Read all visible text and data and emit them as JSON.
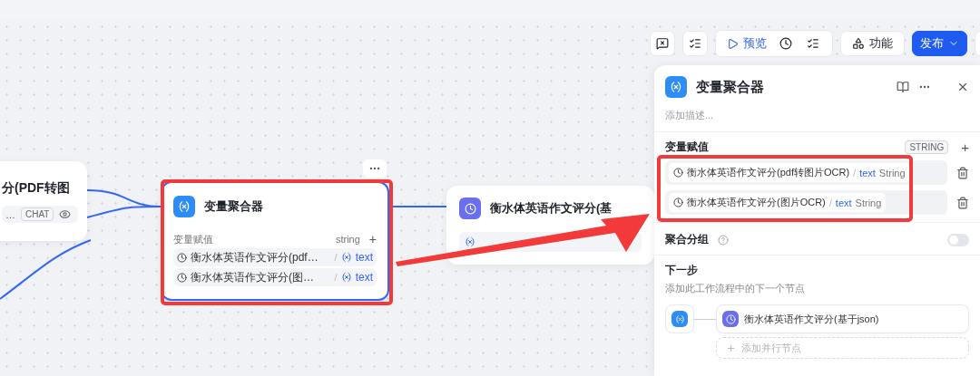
{
  "toolbar": {
    "preview": "预览",
    "features": "功能",
    "publish": "发布"
  },
  "canvas": {
    "nodes": [
      {
        "kind": "source",
        "selected": false,
        "title": "分(PDF转图",
        "rows": [
          {
            "text": "…",
            "badge": "CHAT"
          }
        ]
      },
      {
        "kind": "aggregator",
        "selected": true,
        "title": "变量聚合器",
        "section": "变量赋值",
        "type": "string",
        "add": "+",
        "rows": [
          {
            "name": "衡水体英语作文评分(pdf…",
            "sep": "/",
            "var": "text"
          },
          {
            "name": "衡水体英语作文评分(图…",
            "sep": "/",
            "var": "text"
          }
        ]
      },
      {
        "kind": "llm",
        "selected": false,
        "title": "衡水体英语作文评分(基"
      }
    ]
  },
  "panel": {
    "title": "变量聚合器",
    "description_placeholder": "添加描述...",
    "assign": {
      "label": "变量赋值",
      "type": "STRING",
      "add": "+",
      "rows": [
        {
          "name": "衡水体英语作文评分(pdf转图片OCR)",
          "sep": "/",
          "var": "text",
          "type": "String"
        },
        {
          "name": "衡水体英语作文评分(图片OCR)",
          "sep": "/",
          "var": "text",
          "type": "String"
        }
      ]
    },
    "aggregate_group": {
      "label": "聚合分组",
      "on": false
    },
    "next": {
      "title": "下一步",
      "hint": "添加此工作流程中的下一个节点",
      "node": "衡水体英语作文评分(基于json)",
      "add_parallel": "添加并行节点"
    }
  }
}
